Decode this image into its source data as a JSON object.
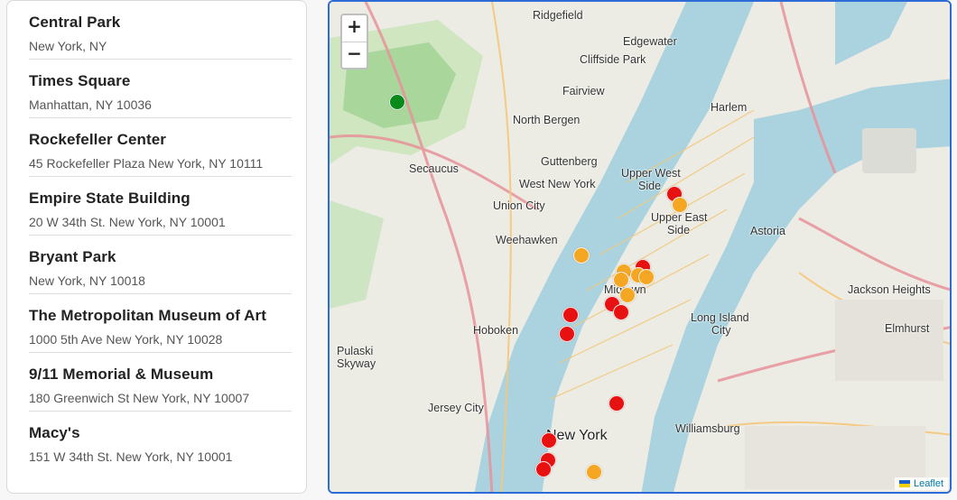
{
  "places": [
    {
      "name": "Central Park",
      "address": "New York, NY"
    },
    {
      "name": "Times Square",
      "address": "Manhattan, NY 10036"
    },
    {
      "name": "Rockefeller Center",
      "address": "45 Rockefeller Plaza New York, NY 10111"
    },
    {
      "name": "Empire State Building",
      "address": "20 W 34th St. New York, NY 10001"
    },
    {
      "name": "Bryant Park",
      "address": "New York, NY 10018"
    },
    {
      "name": "The Metropolitan Museum of Art",
      "address": "1000 5th Ave New York, NY 10028"
    },
    {
      "name": "9/11 Memorial & Museum",
      "address": "180 Greenwich St New York, NY 10007"
    },
    {
      "name": "Macy's",
      "address": "151 W 34th St. New York, NY 10001"
    }
  ],
  "map": {
    "zoom_in": "+",
    "zoom_out": "−",
    "attribution": "Leaflet",
    "labels": {
      "ridgefield": "Ridgefield",
      "edgewater": "Edgewater",
      "cliffside_park": "Cliffside Park",
      "fairview": "Fairview",
      "north_bergen": "North Bergen",
      "guttenberg": "Guttenberg",
      "secaucus": "Secaucus",
      "west_new_york": "West New York",
      "union_city": "Union City",
      "weehawken": "Weehawken",
      "hoboken": "Hoboken",
      "jersey_city": "Jersey City",
      "pulaski": "Pulaski",
      "skyway": "Skyway",
      "harlem": "Harlem",
      "upper_west": "Upper West",
      "side_w": "Side",
      "upper_east": "Upper East",
      "side_e": "Side",
      "astoria": "Astoria",
      "jackson_heights": "Jackson Heights",
      "long_island": "Long Island",
      "city": "City",
      "elmhurst": "Elmhurst",
      "williamsburg": "Williamsburg",
      "new_york": "New York",
      "midtown": "Midtown"
    },
    "marker_colors": {
      "red": "#e81111",
      "orange": "#f5a623",
      "green": "#0a8a1a"
    }
  }
}
